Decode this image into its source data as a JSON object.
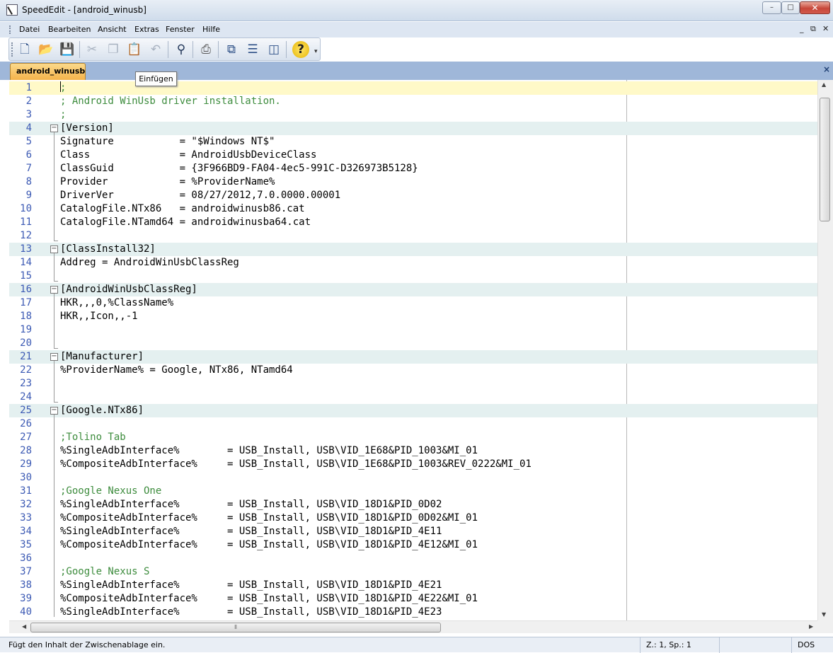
{
  "window": {
    "title": "SpeedEdit - [android_winusb]",
    "min": "–",
    "max": "□",
    "close": "✕"
  },
  "menu": {
    "items": [
      "Datei",
      "Bearbeiten",
      "Ansicht",
      "Extras",
      "Fenster",
      "Hilfe"
    ],
    "mdi": [
      "_",
      "⧉",
      "✕"
    ]
  },
  "toolbar": {
    "icons": [
      "new-file-icon",
      "open-folder-icon",
      "save-disk-icon",
      "cut-icon",
      "copy-icon",
      "paste-icon",
      "undo-icon",
      "find-binoculars-icon",
      "print-icon",
      "windows-cascade-icon",
      "split-horizontal-icon",
      "split-vertical-icon",
      "help-icon"
    ],
    "overflow": "▾"
  },
  "tab": {
    "label": "android_winusb",
    "close": "×"
  },
  "tooltip": {
    "text": "Einfügen"
  },
  "editor": {
    "lines": [
      {
        "n": "1",
        "text": ";",
        "type": "comment"
      },
      {
        "n": "2",
        "text": "; Android WinUsb driver installation.",
        "type": "comment"
      },
      {
        "n": "3",
        "text": ";",
        "type": "comment"
      },
      {
        "n": "4",
        "text": "[Version]",
        "type": "section"
      },
      {
        "n": "5",
        "text": "Signature           = \"$Windows NT$\"",
        "type": "code"
      },
      {
        "n": "6",
        "text": "Class               = AndroidUsbDeviceClass",
        "type": "code"
      },
      {
        "n": "7",
        "text": "ClassGuid           = {3F966BD9-FA04-4ec5-991C-D326973B5128}",
        "type": "code"
      },
      {
        "n": "8",
        "text": "Provider            = %ProviderName%",
        "type": "code"
      },
      {
        "n": "9",
        "text": "DriverVer           = 08/27/2012,7.0.0000.00001",
        "type": "code"
      },
      {
        "n": "10",
        "text": "CatalogFile.NTx86   = androidwinusb86.cat",
        "type": "code"
      },
      {
        "n": "11",
        "text": "CatalogFile.NTamd64 = androidwinusba64.cat",
        "type": "code"
      },
      {
        "n": "12",
        "text": "",
        "type": "code"
      },
      {
        "n": "13",
        "text": "[ClassInstall32]",
        "type": "section"
      },
      {
        "n": "14",
        "text": "Addreg = AndroidWinUsbClassReg",
        "type": "code"
      },
      {
        "n": "15",
        "text": "",
        "type": "code"
      },
      {
        "n": "16",
        "text": "[AndroidWinUsbClassReg]",
        "type": "section"
      },
      {
        "n": "17",
        "text": "HKR,,,0,%ClassName%",
        "type": "code"
      },
      {
        "n": "18",
        "text": "HKR,,Icon,,-1",
        "type": "code"
      },
      {
        "n": "19",
        "text": "",
        "type": "code"
      },
      {
        "n": "20",
        "text": "",
        "type": "code"
      },
      {
        "n": "21",
        "text": "[Manufacturer]",
        "type": "section"
      },
      {
        "n": "22",
        "text": "%ProviderName% = Google, NTx86, NTamd64",
        "type": "code"
      },
      {
        "n": "23",
        "text": "",
        "type": "code"
      },
      {
        "n": "24",
        "text": "",
        "type": "code"
      },
      {
        "n": "25",
        "text": "[Google.NTx86]",
        "type": "section"
      },
      {
        "n": "26",
        "text": "",
        "type": "code"
      },
      {
        "n": "27",
        "text": ";Tolino Tab",
        "type": "comment"
      },
      {
        "n": "28",
        "text": "%SingleAdbInterface%        = USB_Install, USB\\VID_1E68&PID_1003&MI_01",
        "type": "code"
      },
      {
        "n": "29",
        "text": "%CompositeAdbInterface%     = USB_Install, USB\\VID_1E68&PID_1003&REV_0222&MI_01",
        "type": "code"
      },
      {
        "n": "30",
        "text": "",
        "type": "code"
      },
      {
        "n": "31",
        "text": ";Google Nexus One",
        "type": "comment"
      },
      {
        "n": "32",
        "text": "%SingleAdbInterface%        = USB_Install, USB\\VID_18D1&PID_0D02",
        "type": "code"
      },
      {
        "n": "33",
        "text": "%CompositeAdbInterface%     = USB_Install, USB\\VID_18D1&PID_0D02&MI_01",
        "type": "code"
      },
      {
        "n": "34",
        "text": "%SingleAdbInterface%        = USB_Install, USB\\VID_18D1&PID_4E11",
        "type": "code"
      },
      {
        "n": "35",
        "text": "%CompositeAdbInterface%     = USB_Install, USB\\VID_18D1&PID_4E12&MI_01",
        "type": "code"
      },
      {
        "n": "36",
        "text": "",
        "type": "code"
      },
      {
        "n": "37",
        "text": ";Google Nexus S",
        "type": "comment"
      },
      {
        "n": "38",
        "text": "%SingleAdbInterface%        = USB_Install, USB\\VID_18D1&PID_4E21",
        "type": "code"
      },
      {
        "n": "39",
        "text": "%CompositeAdbInterface%     = USB_Install, USB\\VID_18D1&PID_4E22&MI_01",
        "type": "code"
      },
      {
        "n": "40",
        "text": "%SingleAdbInterface%        = USB_Install, USB\\VID_18D1&PID_4E23",
        "type": "code"
      }
    ],
    "current_line": "1",
    "colors": {
      "comment": "#3d8c3d",
      "linenum": "#3c5ab4",
      "section_bg": "#e4f0f0",
      "current_bg": "#fff9c8"
    }
  },
  "status": {
    "message": "Fügt den Inhalt der Zwischenablage ein.",
    "position": "Z.: 1, Sp.: 1",
    "format": "DOS"
  }
}
